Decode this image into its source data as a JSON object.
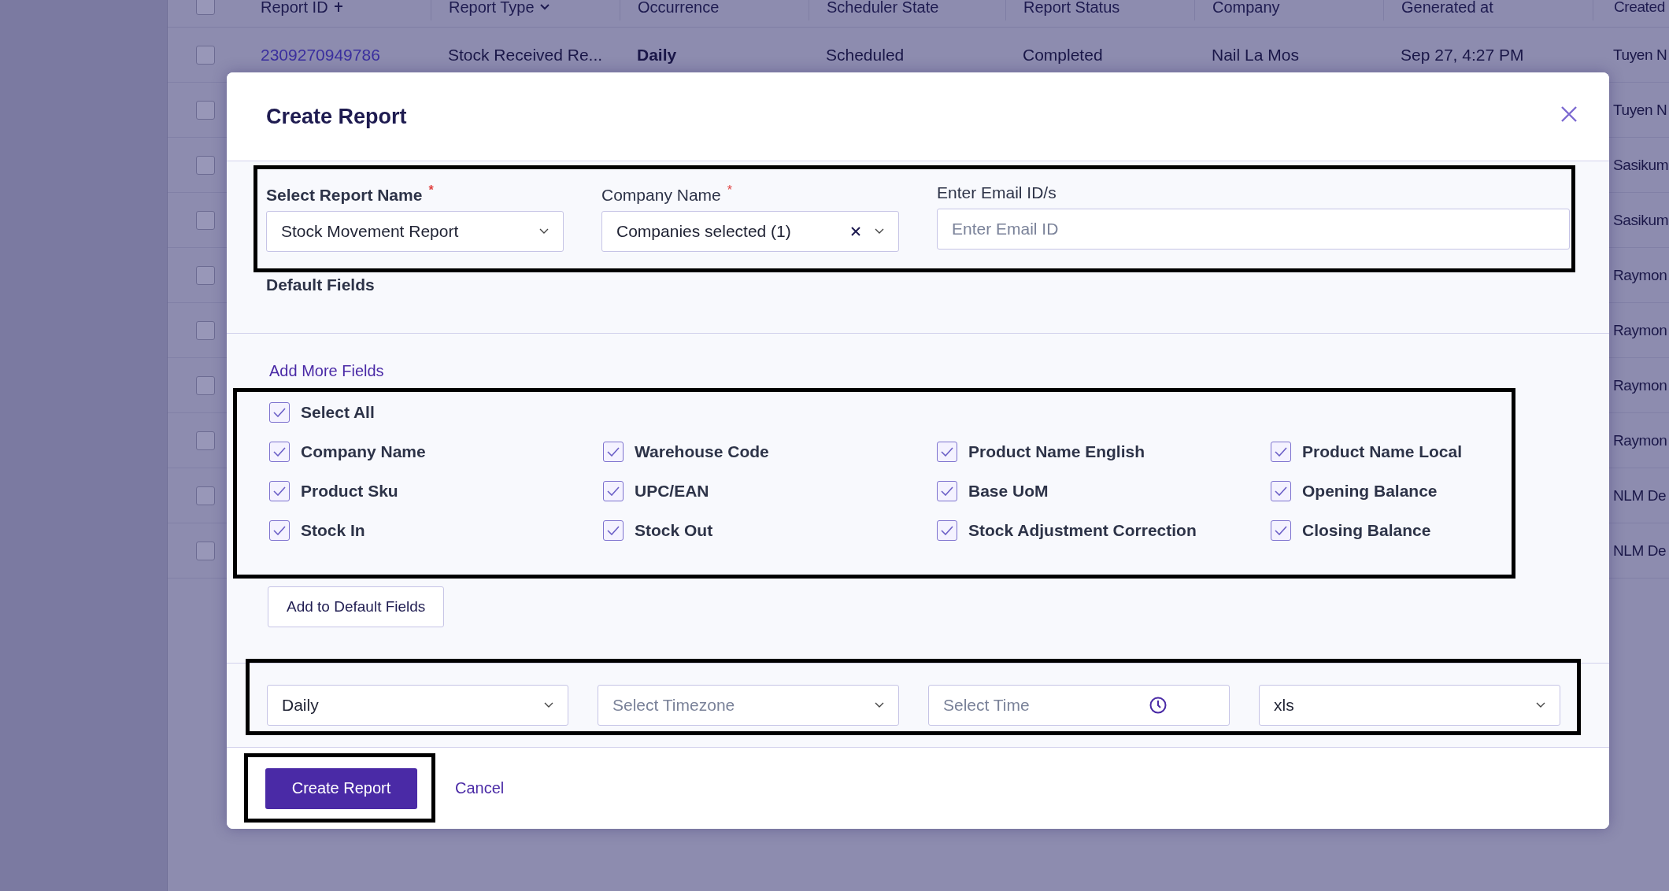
{
  "table": {
    "header_checked": false,
    "columns": [
      "Report ID",
      "Report Type",
      "Occurrence",
      "Scheduler State",
      "Report Status",
      "Company",
      "Generated at",
      "Created"
    ],
    "rows": [
      {
        "checked": false,
        "report_id": "2309270949786",
        "report_type": "Stock Received Re...",
        "occurrence": "Daily",
        "scheduler_state": "Scheduled",
        "report_status": "Completed",
        "company": "Nail La Mos",
        "generated_at": "Sep 27, 4:27 PM",
        "created_by": "Tuyen N"
      },
      {
        "checked": false,
        "created_by": "Tuyen N"
      },
      {
        "checked": false,
        "created_by": "Sasikum"
      },
      {
        "checked": false,
        "created_by": "Sasikum"
      },
      {
        "checked": false,
        "created_by": "Raymon"
      },
      {
        "checked": false,
        "created_by": "Raymon"
      },
      {
        "checked": false,
        "created_by": "Raymon"
      },
      {
        "checked": false,
        "created_by": "Raymon"
      },
      {
        "checked": false,
        "created_by": "NLM De"
      },
      {
        "checked": false,
        "created_by": "NLM De"
      }
    ]
  },
  "dialog": {
    "title": "Create Report",
    "fields": [
      {
        "label": "Select Report Name",
        "required_mark": "*",
        "kind": "select",
        "value": "Stock Movement Report"
      },
      {
        "label": "Company Name",
        "required_mark": "*",
        "kind": "multiselect",
        "value": "Companies selected (1)"
      },
      {
        "label": "Enter Email ID/s",
        "kind": "text",
        "placeholder": "Enter Email ID"
      }
    ],
    "default_fields_heading": "Default Fields",
    "add_more_link": "Add More Fields",
    "select_all": {
      "label": "Select All",
      "checked": true
    },
    "report_fields": [
      {
        "label": "Company Name",
        "checked": true
      },
      {
        "label": "Warehouse Code",
        "checked": true
      },
      {
        "label": "Product Name English",
        "checked": true
      },
      {
        "label": "Product Name Local",
        "checked": true
      },
      {
        "label": "Product Sku",
        "checked": true
      },
      {
        "label": "UPC/EAN",
        "checked": true
      },
      {
        "label": "Base UoM",
        "checked": true
      },
      {
        "label": "Opening Balance",
        "checked": true
      },
      {
        "label": "Stock In",
        "checked": true
      },
      {
        "label": "Stock Out",
        "checked": true
      },
      {
        "label": "Stock Adjustment Correction",
        "checked": true
      },
      {
        "label": "Closing Balance",
        "checked": true
      }
    ],
    "add_button": "Add to Default Fields",
    "schedule": [
      {
        "kind": "select",
        "value": "Daily"
      },
      {
        "kind": "select",
        "placeholder": "Select Timezone"
      },
      {
        "kind": "time",
        "placeholder": "Select Time"
      },
      {
        "kind": "select",
        "value": "xls"
      }
    ],
    "submit_button": "Create Report",
    "cancel_link": "Cancel"
  }
}
